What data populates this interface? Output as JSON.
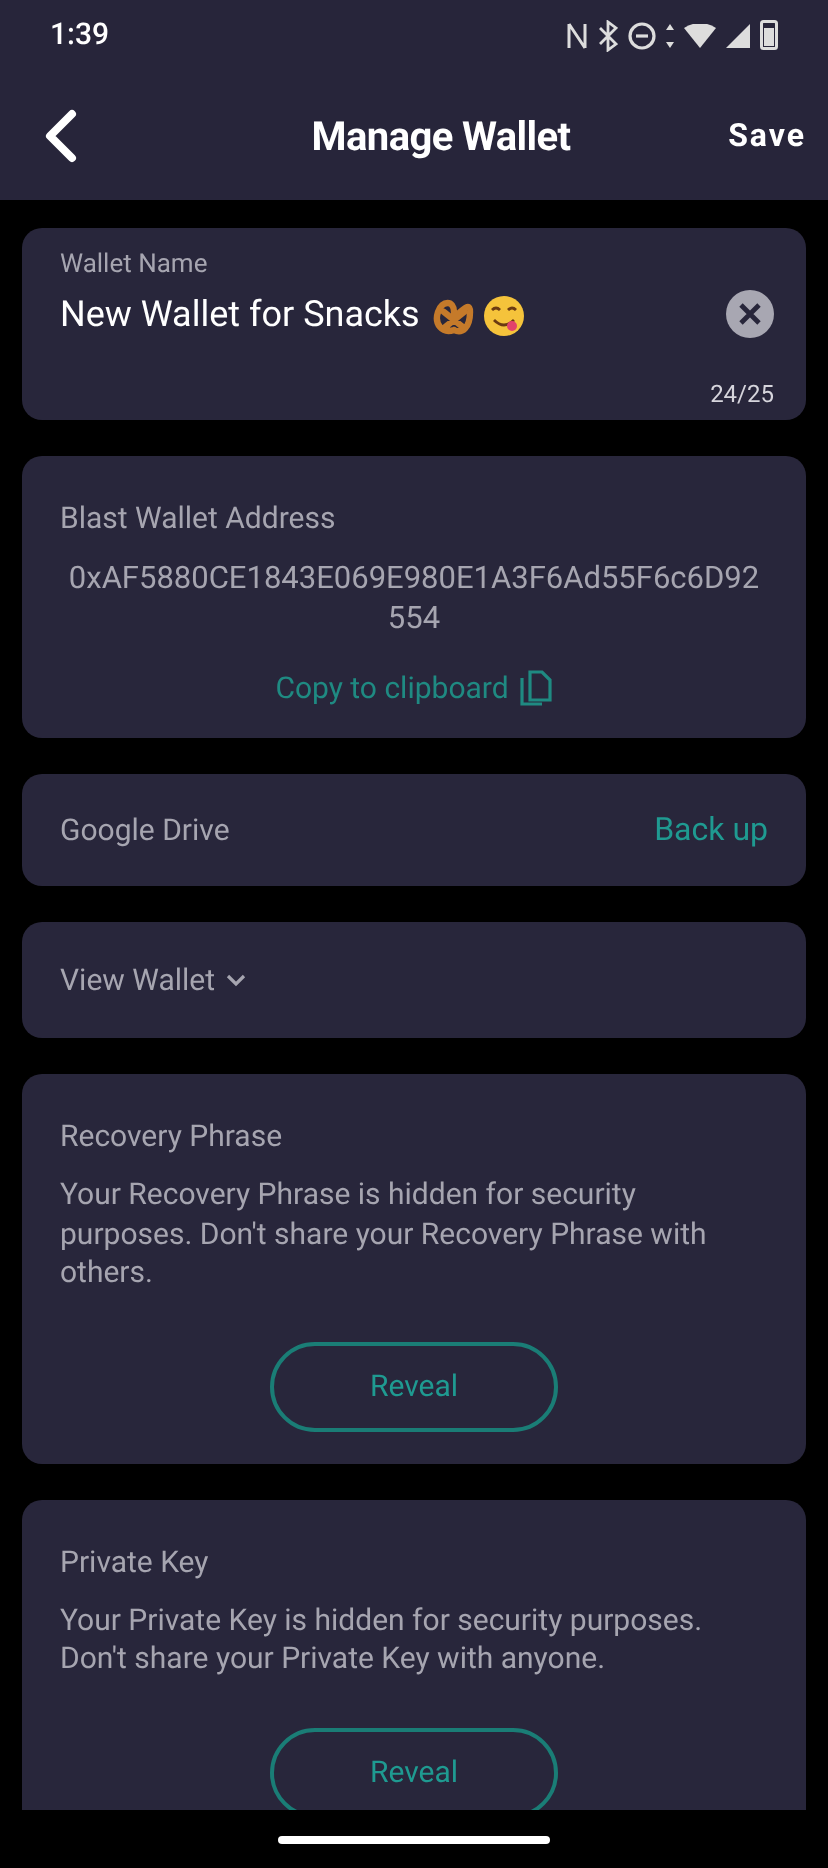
{
  "status_bar": {
    "time": "1:39"
  },
  "header": {
    "title": "Manage Wallet",
    "action": "Save"
  },
  "wallet_name": {
    "label": "Wallet Name",
    "value": "New Wallet for Snacks",
    "counter": "24/25"
  },
  "address_card": {
    "title": "Blast Wallet Address",
    "address": "0xAF5880CE1843E069E980E1A3F6Ad55F6c6D92554",
    "copy_link": "Copy to clipboard"
  },
  "backup_card": {
    "label": "Google Drive",
    "action": "Back up"
  },
  "view_wallet": {
    "label": "View Wallet",
    "expanded": false
  },
  "secret_cards": [
    {
      "title": "Recovery Phrase",
      "text": "Your Recovery Phrase is hidden for security purposes. Don't share your Recovery Phrase with others.",
      "button": "Reveal"
    },
    {
      "title": "Private Key",
      "text": "Your Private Key is hidden for security purposes. Don't share your Private Key with anyone.",
      "button": "Reveal"
    }
  ]
}
